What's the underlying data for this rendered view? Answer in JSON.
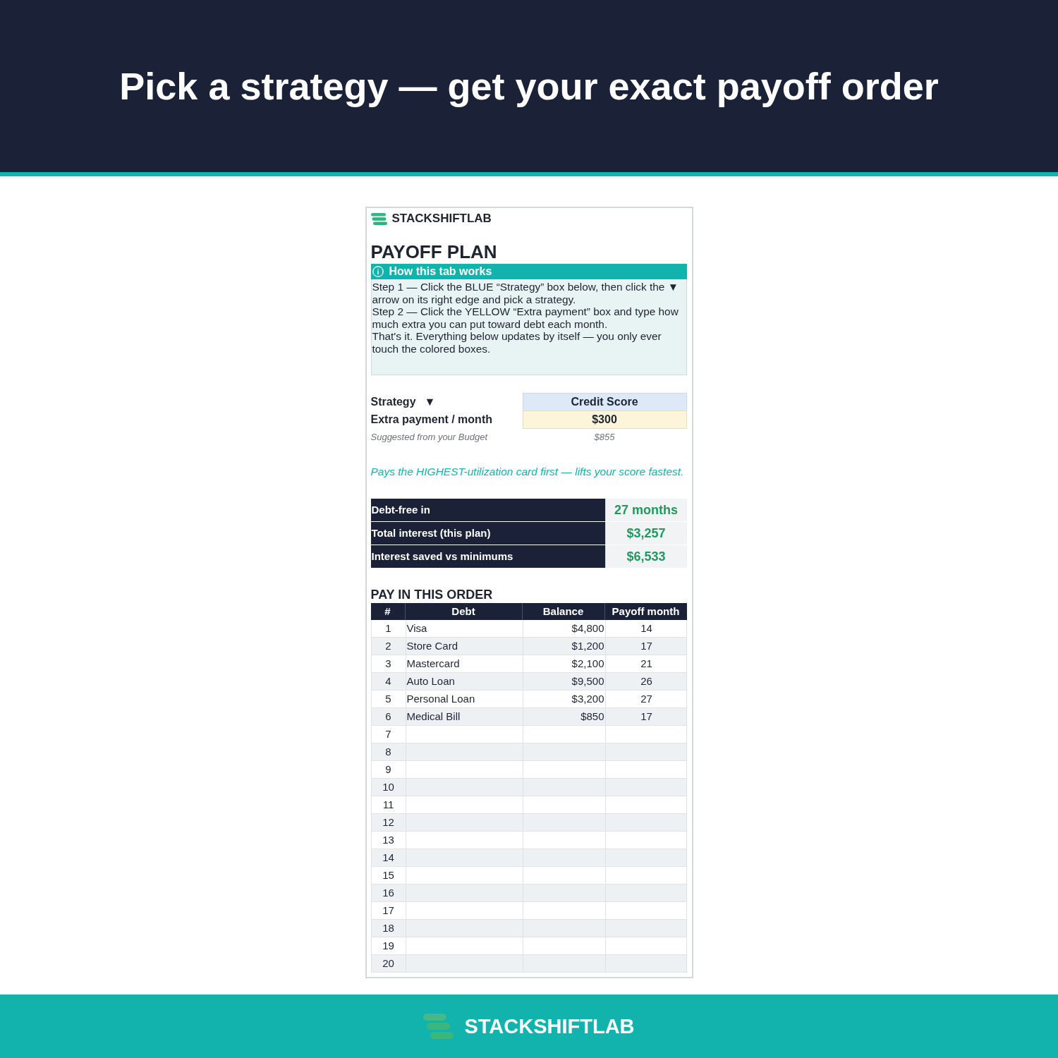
{
  "header": {
    "title": "Pick a strategy — get your exact payoff order"
  },
  "card": {
    "brand": "STACKSHIFTLAB",
    "title": "PAYOFF PLAN",
    "help": {
      "heading": "How this tab works",
      "lines": [
        "Step 1 — Click the BLUE “Strategy” box below, then click the ▼ arrow on its right edge and pick a strategy.",
        "Step 2 — Click the YELLOW “Extra payment” box and type how much extra you can put toward debt each month.",
        "That's it. Everything below updates by itself — you only ever touch the colored boxes."
      ]
    },
    "settings": [
      {
        "kind": "dropdown",
        "label": "Strategy",
        "glyph": "▼",
        "value": "Credit Score"
      },
      {
        "kind": "input",
        "label": "Extra payment / month",
        "value": "$300"
      },
      {
        "kind": "note",
        "label": "Suggested from your Budget",
        "value": "$855"
      }
    ],
    "strategy_description": "Pays the HIGHEST-utilization card first — lifts your score fastest.",
    "summary": [
      {
        "label": "Debt-free in",
        "value": "27 months"
      },
      {
        "label": "Total interest (this plan)",
        "value": "$3,257"
      },
      {
        "label": "Interest saved vs minimums",
        "value": "$6,533"
      }
    ],
    "order_table": {
      "title": "PAY IN THIS ORDER",
      "columns": [
        "#",
        "Debt",
        "Balance",
        "Payoff month"
      ],
      "rows": [
        {
          "number": "1",
          "debt": "Visa",
          "balance": "$4,800",
          "payoff_month": "14"
        },
        {
          "number": "2",
          "debt": "Store Card",
          "balance": "$1,200",
          "payoff_month": "17"
        },
        {
          "number": "3",
          "debt": "Mastercard",
          "balance": "$2,100",
          "payoff_month": "21"
        },
        {
          "number": "4",
          "debt": "Auto Loan",
          "balance": "$9,500",
          "payoff_month": "26"
        },
        {
          "number": "5",
          "debt": "Personal Loan",
          "balance": "$3,200",
          "payoff_month": "27"
        },
        {
          "number": "6",
          "debt": "Medical Bill",
          "balance": "$850",
          "payoff_month": "17"
        },
        {
          "number": "7"
        },
        {
          "number": "8"
        },
        {
          "number": "9"
        },
        {
          "number": "10"
        },
        {
          "number": "11"
        },
        {
          "number": "12"
        },
        {
          "number": "13"
        },
        {
          "number": "14"
        },
        {
          "number": "15"
        },
        {
          "number": "16"
        },
        {
          "number": "17"
        },
        {
          "number": "18"
        },
        {
          "number": "19"
        },
        {
          "number": "20"
        }
      ]
    }
  },
  "footer": {
    "brand": "STACKSHIFTLAB"
  }
}
